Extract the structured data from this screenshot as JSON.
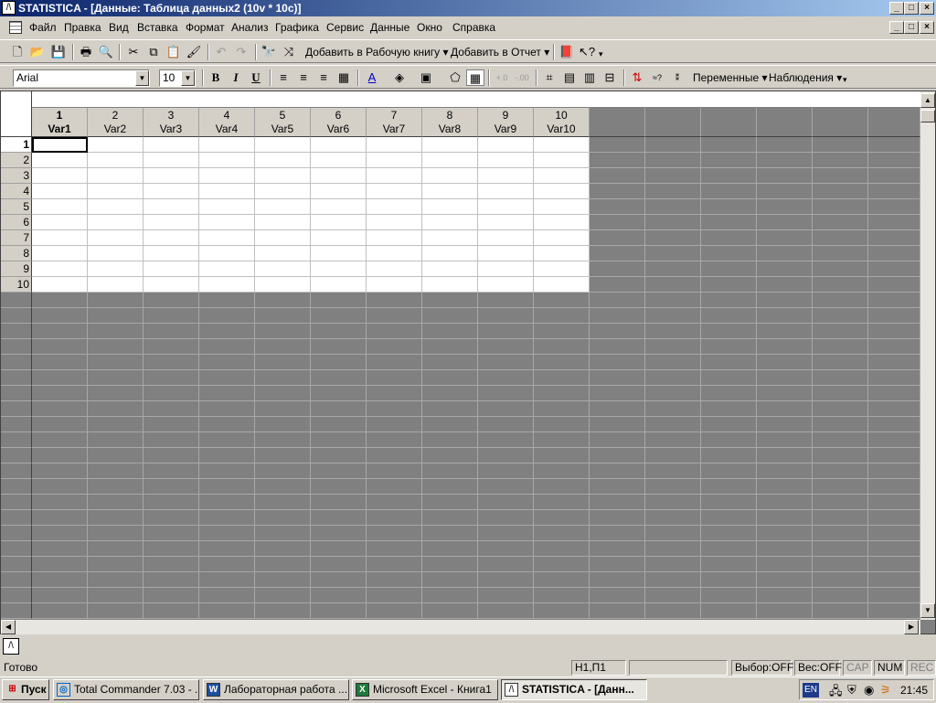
{
  "window": {
    "title": "STATISTICA - [Данные: Таблица данных2 (10v * 10c)]",
    "app_icon": "statistica-icon",
    "controls": [
      "_",
      "□",
      "×"
    ]
  },
  "menu": [
    "Файл",
    "Правка",
    "Вид",
    "Вставка",
    "Формат",
    "Анализ",
    "Графика",
    "Сервис",
    "Данные",
    "Окно",
    "Справка"
  ],
  "toolbar1": {
    "add_workbook": "Добавить в Рабочую книгу",
    "add_report": "Добавить в Отчет"
  },
  "toolbar2": {
    "font": "Arial",
    "size": "10",
    "bold": "B",
    "italic": "I",
    "underline": "U",
    "variables": "Переменные",
    "cases": "Наблюдения"
  },
  "spreadsheet": {
    "columns": [
      {
        "num": "1",
        "name": "Var1"
      },
      {
        "num": "2",
        "name": "Var2"
      },
      {
        "num": "3",
        "name": "Var3"
      },
      {
        "num": "4",
        "name": "Var4"
      },
      {
        "num": "5",
        "name": "Var5"
      },
      {
        "num": "6",
        "name": "Var6"
      },
      {
        "num": "7",
        "name": "Var7"
      },
      {
        "num": "8",
        "name": "Var8"
      },
      {
        "num": "9",
        "name": "Var9"
      },
      {
        "num": "10",
        "name": "Var10"
      }
    ],
    "rows": [
      "1",
      "2",
      "3",
      "4",
      "5",
      "6",
      "7",
      "8",
      "9",
      "10"
    ],
    "selected_cell": "1,1"
  },
  "status": {
    "ready": "Готово",
    "position": "Н1,П1",
    "selection": "Выбор:OFF",
    "weight": "Вес:OFF",
    "cap": "CAP",
    "num": "NUM",
    "rec": "REC"
  },
  "taskbar": {
    "start": "Пуск",
    "tasks": [
      "Total Commander 7.03 - ...",
      "Лабораторная работа ...",
      "Microsoft Excel - Книга1",
      "STATISTICA - [Данн..."
    ],
    "lang": "EN",
    "clock": "21:45"
  }
}
